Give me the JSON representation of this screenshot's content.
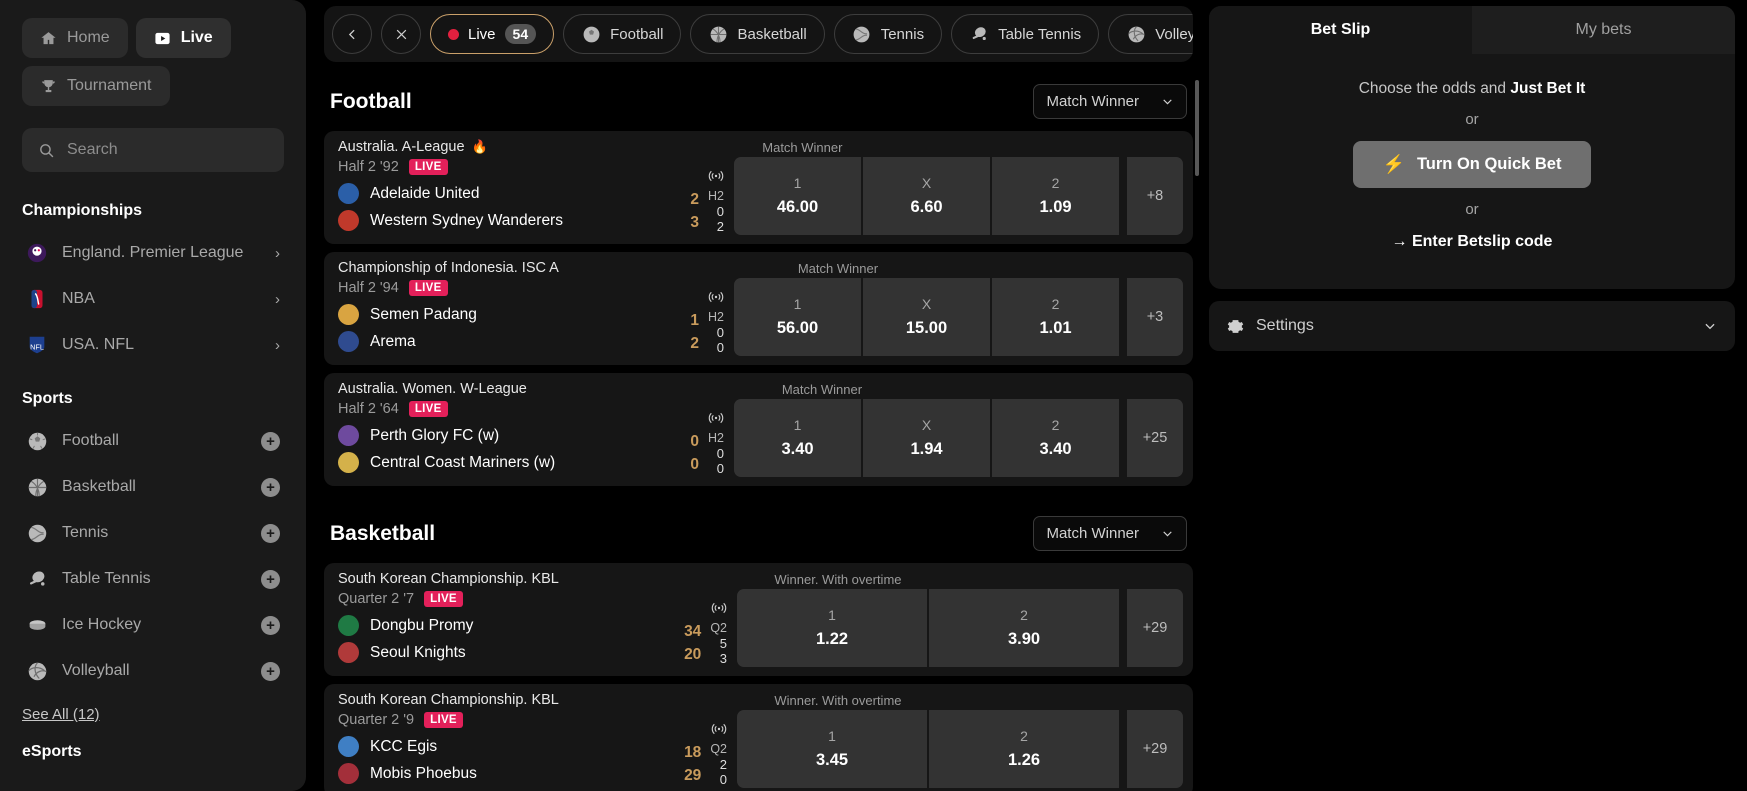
{
  "sidebar": {
    "nav": [
      {
        "label": "Home",
        "icon": "home-icon",
        "active": false
      },
      {
        "label": "Live",
        "icon": "live-play-icon",
        "active": true
      },
      {
        "label": "Tournament",
        "icon": "trophy-icon",
        "active": false
      }
    ],
    "search": {
      "placeholder": "Search",
      "value": "",
      "icon": "search-icon"
    },
    "championships_title": "Championships",
    "championships": [
      {
        "label": "England. Premier League",
        "icon": "premier-league-icon",
        "chevron": "›"
      },
      {
        "label": "NBA",
        "icon": "nba-icon",
        "chevron": "›"
      },
      {
        "label": "USA. NFL",
        "icon": "nfl-icon",
        "chevron": "›"
      }
    ],
    "sports_title": "Sports",
    "sports": [
      {
        "label": "Football",
        "icon": "football-icon",
        "add": "+"
      },
      {
        "label": "Basketball",
        "icon": "basketball-icon",
        "add": "+"
      },
      {
        "label": "Tennis",
        "icon": "tennis-icon",
        "add": "+"
      },
      {
        "label": "Table Tennis",
        "icon": "table-tennis-icon",
        "add": "+"
      },
      {
        "label": "Ice Hockey",
        "icon": "ice-hockey-icon",
        "add": "+"
      },
      {
        "label": "Volleyball",
        "icon": "volleyball-icon",
        "add": "+"
      }
    ],
    "see_all": "See All (12)",
    "esports_title": "eSports"
  },
  "sport_tabs": {
    "prev_icon": "chevron-left-icon",
    "close_icon": "close-icon",
    "next_icon": "chevron-right-icon",
    "items": [
      {
        "label": "Live",
        "count": "54",
        "icon": "live-dot-icon",
        "active": true
      },
      {
        "label": "Football",
        "icon": "football-icon",
        "active": false
      },
      {
        "label": "Basketball",
        "icon": "basketball-icon",
        "active": false
      },
      {
        "label": "Tennis",
        "icon": "tennis-icon",
        "active": false
      },
      {
        "label": "Table Tennis",
        "icon": "table-tennis-icon",
        "active": false
      },
      {
        "label": "Volleyball",
        "icon": "volleyball-icon",
        "active": false
      }
    ]
  },
  "groups": [
    {
      "title": "Football",
      "market_select": "Match Winner",
      "matches": [
        {
          "league": "Australia. A-League",
          "hot": "🔥",
          "market": "Match Winner",
          "period": "Half 2 '92",
          "live_tag": "LIVE",
          "stream_icon": "broadcast-icon",
          "period_col_label": "H2",
          "teams": [
            {
              "name": "Adelaide United",
              "logo_color": "#2b5fa8",
              "score": "2",
              "period_score": "0"
            },
            {
              "name": "Western Sydney Wanderers",
              "logo_color": "#c0392b",
              "score": "3",
              "period_score": "2"
            }
          ],
          "odds": [
            {
              "name": "1",
              "value": "46.00"
            },
            {
              "name": "X",
              "value": "6.60"
            },
            {
              "name": "2",
              "value": "1.09"
            }
          ],
          "more": "+8"
        },
        {
          "league": "Championship of Indonesia. ISC A",
          "hot": "",
          "market": "Match Winner",
          "period": "Half 2 '94",
          "live_tag": "LIVE",
          "stream_icon": "broadcast-icon",
          "period_col_label": "H2",
          "teams": [
            {
              "name": "Semen Padang",
              "logo_color": "#d9a441",
              "score": "1",
              "period_score": "0"
            },
            {
              "name": "Arema",
              "logo_color": "#2f4b8f",
              "score": "2",
              "period_score": "0"
            }
          ],
          "odds": [
            {
              "name": "1",
              "value": "56.00"
            },
            {
              "name": "X",
              "value": "15.00"
            },
            {
              "name": "2",
              "value": "1.01"
            }
          ],
          "more": "+3"
        },
        {
          "league": "Australia. Women. W-League",
          "hot": "",
          "market": "Match Winner",
          "period": "Half 2 '64",
          "live_tag": "LIVE",
          "stream_icon": "broadcast-icon",
          "period_col_label": "H2",
          "teams": [
            {
              "name": "Perth Glory FC (w)",
              "logo_color": "#6e4a9e",
              "score": "0",
              "period_score": "0"
            },
            {
              "name": "Central Coast Mariners (w)",
              "logo_color": "#d4b14a",
              "score": "0",
              "period_score": "0"
            }
          ],
          "odds": [
            {
              "name": "1",
              "value": "3.40"
            },
            {
              "name": "X",
              "value": "1.94"
            },
            {
              "name": "2",
              "value": "3.40"
            }
          ],
          "more": "+25"
        }
      ]
    },
    {
      "title": "Basketball",
      "market_select": "Match Winner",
      "matches": [
        {
          "league": "South Korean Championship. KBL",
          "hot": "",
          "market": "Winner. With overtime",
          "period": "Quarter 2 '7",
          "live_tag": "LIVE",
          "stream_icon": "broadcast-icon",
          "period_col_label": "Q2",
          "teams": [
            {
              "name": "Dongbu Promy",
              "logo_color": "#1f7a44",
              "score": "34",
              "period_score": "5"
            },
            {
              "name": "Seoul Knights",
              "logo_color": "#b03a3a",
              "score": "20",
              "period_score": "3"
            }
          ],
          "odds": [
            {
              "name": "1",
              "value": "1.22"
            },
            {
              "name": "2",
              "value": "3.90"
            }
          ],
          "more": "+29"
        },
        {
          "league": "South Korean Championship. KBL",
          "hot": "",
          "market": "Winner. With overtime",
          "period": "Quarter 2 '9",
          "live_tag": "LIVE",
          "stream_icon": "broadcast-icon",
          "period_col_label": "Q2",
          "teams": [
            {
              "name": "KCC Egis",
              "logo_color": "#3f7fc4",
              "score": "18",
              "period_score": "2"
            },
            {
              "name": "Mobis Phoebus",
              "logo_color": "#a32f3a",
              "score": "29",
              "period_score": "0"
            }
          ],
          "odds": [
            {
              "name": "1",
              "value": "3.45"
            },
            {
              "name": "2",
              "value": "1.26"
            }
          ],
          "more": "+29"
        }
      ]
    }
  ],
  "bet_slip": {
    "tabs": [
      {
        "label": "Bet Slip",
        "active": true
      },
      {
        "label": "My bets",
        "active": false
      }
    ],
    "hint_prefix": "Choose the odds and ",
    "hint_bold": "Just Bet It",
    "or_1": "or",
    "quick_bet": "Turn On Quick Bet",
    "quick_bet_icon": "bolt-icon",
    "or_2": "or",
    "betslip_code": "→ Enter Betslip code",
    "settings": "Settings",
    "settings_icon": "gear-icon",
    "settings_chevron": "chevron-down-icon"
  },
  "colors": {
    "accent_gold": "#c99b5c",
    "live_red": "#e3205a",
    "panel": "#161616",
    "odd_bg": "#333333"
  }
}
